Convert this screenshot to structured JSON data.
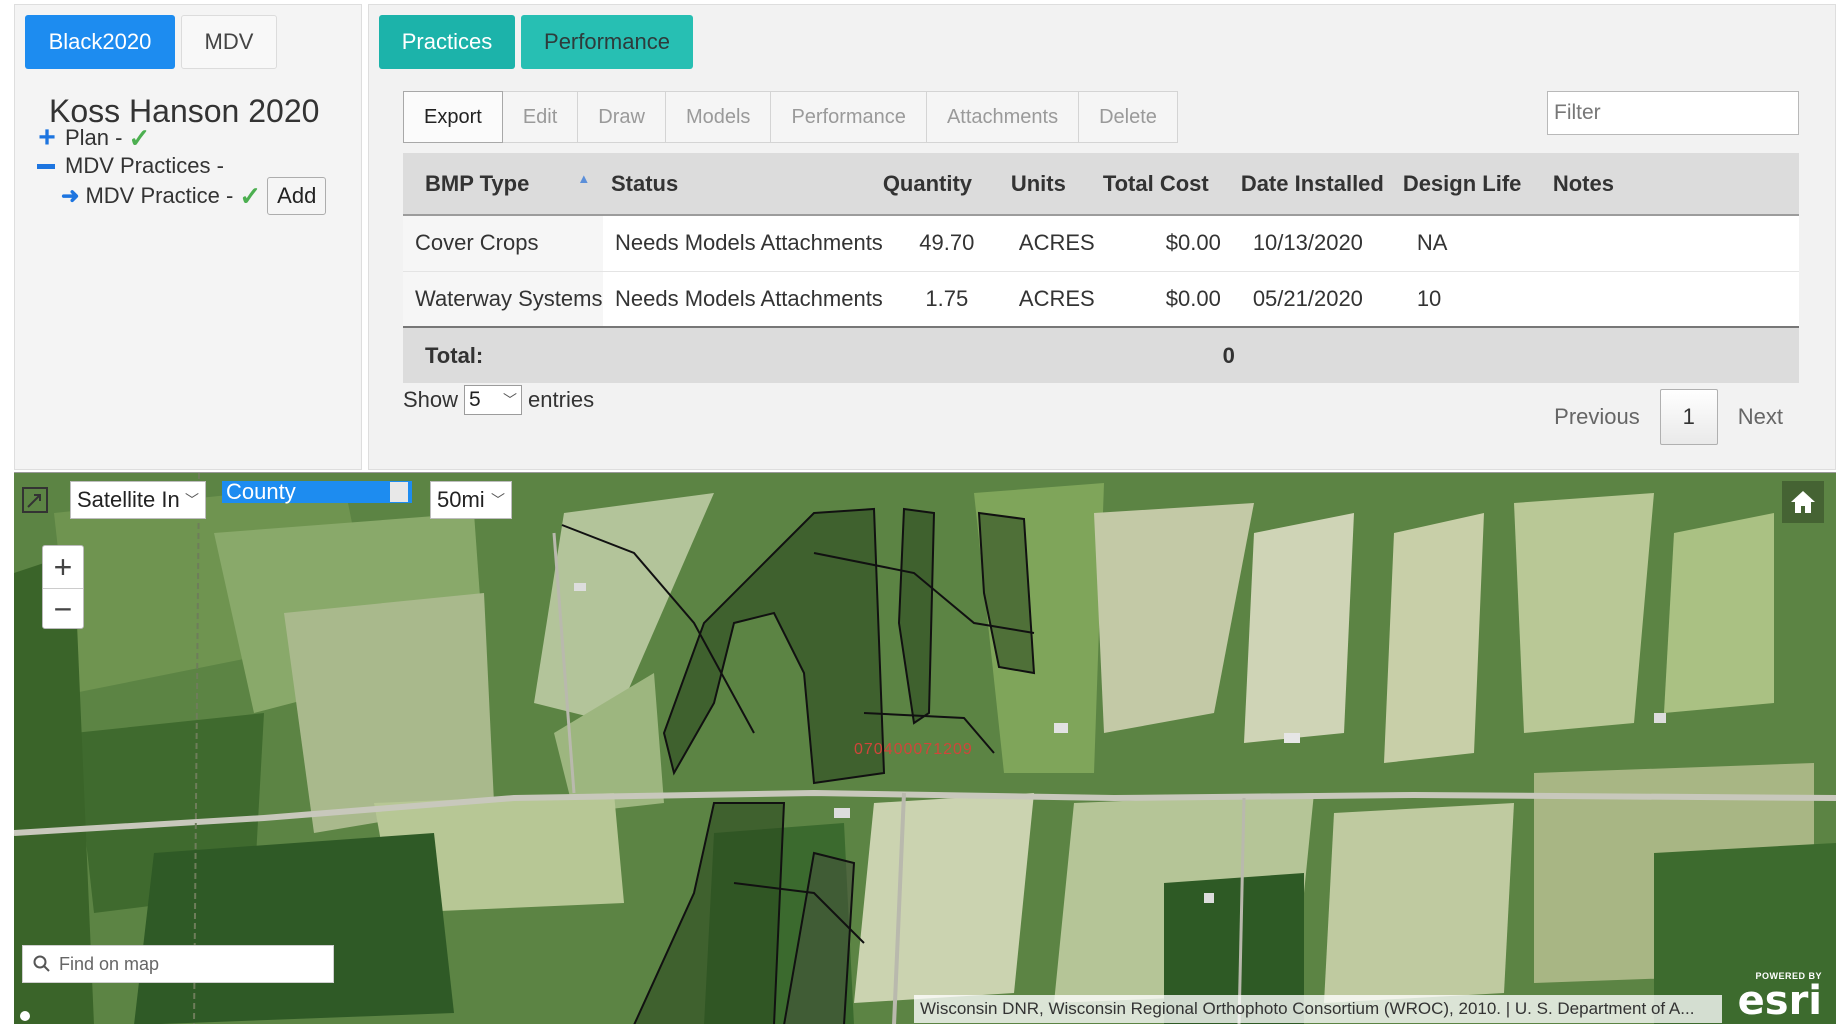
{
  "left_panel": {
    "tabs": [
      {
        "label": "Black2020"
      },
      {
        "label": "MDV"
      }
    ],
    "title": "Koss Hanson 2020",
    "tree": {
      "plan_label": "Plan -",
      "practices_label": "MDV Practices -",
      "practice_label": "MDV Practice -",
      "add_label": "Add"
    }
  },
  "right_panel": {
    "tabs": [
      {
        "label": "Practices"
      },
      {
        "label": "Performance"
      }
    ],
    "toolbar": [
      "Export",
      "Edit",
      "Draw",
      "Models",
      "Performance",
      "Attachments",
      "Delete"
    ],
    "filter_placeholder": "Filter",
    "table": {
      "headers": [
        "BMP Type",
        "Status",
        "Quantity",
        "Units",
        "Total Cost",
        "Date Installed",
        "Design Life",
        "Notes"
      ],
      "rows": [
        [
          "Cover Crops",
          "Needs Models Attachments",
          "49.70",
          "ACRES",
          "$0.00",
          "10/13/2020",
          "NA",
          ""
        ],
        [
          "Waterway Systems",
          "Needs Models Attachments",
          "1.75",
          "ACRES",
          "$0.00",
          "05/21/2020",
          "10",
          ""
        ]
      ],
      "total_label": "Total:",
      "total_value": "0"
    },
    "show_label": "Show",
    "show_value": "5",
    "entries_label": "entries",
    "pager": {
      "previous": "Previous",
      "current": "1",
      "next": "Next"
    }
  },
  "map": {
    "basemap_select": "Satellite In",
    "layer_select": "County",
    "radius_select": "50mi",
    "zoom_in": "+",
    "zoom_out": "−",
    "search_placeholder": "Find on map",
    "parcel_label": "070400071209",
    "attribution": "Wisconsin DNR, Wisconsin Regional Orthophoto Consortium (WROC), 2010. | U. S. Department of A...",
    "esri_powered": "POWERED BY",
    "esri_name": "esri"
  },
  "colors": {
    "tab_blue": "#1d8cf0",
    "tab_teal": "#1cb3aa",
    "check_green": "#4caf50",
    "icon_blue": "#1d75e0"
  }
}
